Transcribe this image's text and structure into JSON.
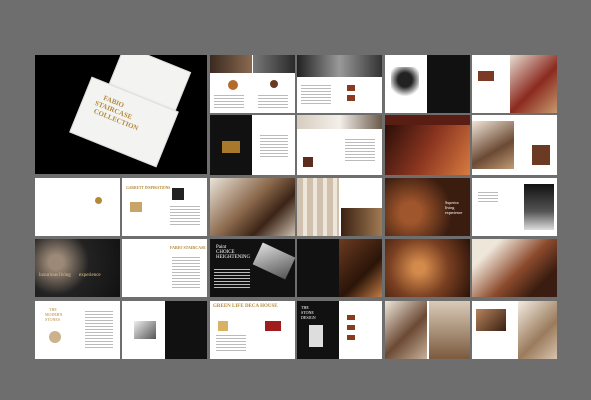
{
  "cover": {
    "title_lines": [
      "FABIO",
      "STAIRCASE",
      "COLLECTION"
    ]
  },
  "spreads": {
    "inspirations": "GARRETT INSPIRATIONS",
    "stair_title": "HANDMADE STAIRCASE",
    "lux_title": "luxurious living",
    "lux_sub": "experience",
    "fabio_stair": "FABIO STAIRCASE",
    "paint_lines": [
      "Paint",
      "CHOICE",
      "HEIGHTENING"
    ],
    "green_title": "GREEN LIFE DECA HOUSE",
    "stone_lines": [
      "THE",
      "MODERN",
      "STONES"
    ],
    "the_stone": [
      "THE",
      "STONE",
      "DESIGN"
    ],
    "superior_lines": [
      "Superior",
      "living",
      "experience"
    ]
  }
}
